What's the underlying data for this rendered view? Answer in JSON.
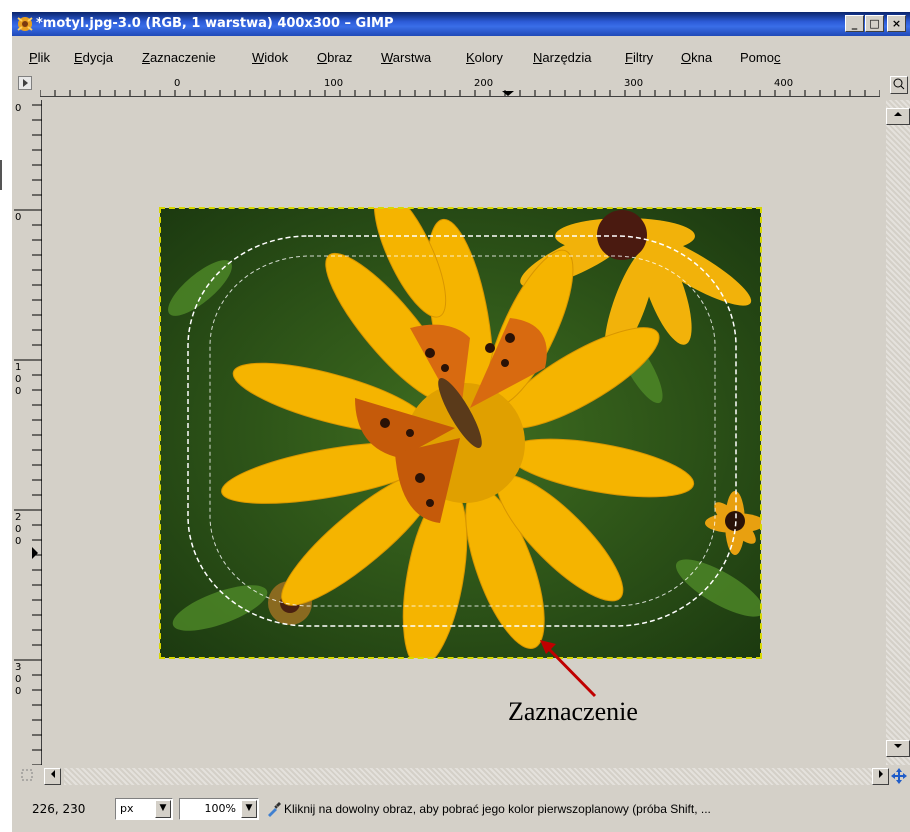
{
  "window": {
    "title": "*motyl.jpg-3.0 (RGB, 1 warstwa) 400x300 – GIMP",
    "app_icon": "gimp-wilber-icon",
    "buttons": {
      "minimize": "_",
      "maximize": "□",
      "close": "×"
    }
  },
  "menu": {
    "items": [
      {
        "pre": "",
        "u": "P",
        "post": "lik"
      },
      {
        "pre": "",
        "u": "E",
        "post": "dycja"
      },
      {
        "pre": "",
        "u": "Z",
        "post": "aznaczenie"
      },
      {
        "pre": "",
        "u": "W",
        "post": "idok"
      },
      {
        "pre": "",
        "u": "O",
        "post": "braz"
      },
      {
        "pre": "",
        "u": "W",
        "post": "arstwa"
      },
      {
        "pre": "",
        "u": "K",
        "post": "olory"
      },
      {
        "pre": "",
        "u": "N",
        "post": "arzędzia"
      },
      {
        "pre": "",
        "u": "F",
        "post": "iltry"
      },
      {
        "pre": "",
        "u": "O",
        "post": "kna"
      },
      {
        "pre": "Pomo",
        "u": "c",
        "post": ""
      }
    ]
  },
  "rulers": {
    "horizontal_labels": [
      "0",
      "100",
      "200",
      "300",
      "400"
    ],
    "vertical_labels": [
      [
        "0"
      ],
      [
        "0"
      ],
      [
        "1",
        "0",
        "0"
      ],
      [
        "2",
        "0",
        "0"
      ],
      [
        "3",
        "0",
        "0"
      ]
    ]
  },
  "status": {
    "coords": "226, 230",
    "unit": "px",
    "zoom": "100%",
    "message": "Kliknij na dowolny obraz, aby pobrać jego kolor pierwszoplanowy (próba Shift, ..."
  },
  "annotation": {
    "label": "Zaznaczenie",
    "color": "#c00000"
  },
  "colors": {
    "chrome": "#d4d0c8",
    "title_blue": "#0a246a",
    "petal_yellow": "#f5b400",
    "butterfly_orange": "#d86a10",
    "leaf_green": "#2f5a1a",
    "selection_marquee": "#ffffff"
  }
}
